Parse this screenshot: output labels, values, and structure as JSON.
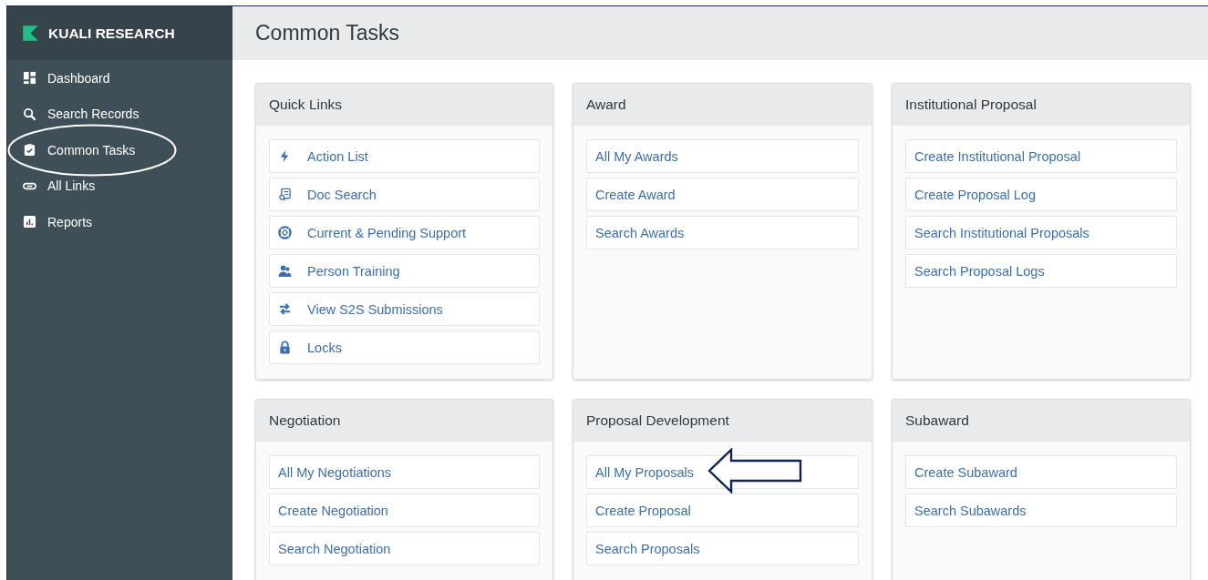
{
  "sidebar": {
    "brand": "KUALI RESEARCH",
    "items": [
      {
        "label": "Dashboard",
        "circled": false
      },
      {
        "label": "Search Records",
        "circled": false
      },
      {
        "label": "Common Tasks",
        "circled": true
      },
      {
        "label": "All Links",
        "circled": false
      },
      {
        "label": "Reports",
        "circled": false
      }
    ]
  },
  "page_title": "Common Tasks",
  "sections": [
    {
      "title": "Quick Links",
      "kind": "icon-links",
      "links": [
        {
          "label": "Action List",
          "arrow": false
        },
        {
          "label": "Doc Search",
          "arrow": false
        },
        {
          "label": "Current & Pending Support",
          "arrow": false
        },
        {
          "label": "Person Training",
          "arrow": false
        },
        {
          "label": "View S2S Submissions",
          "arrow": false
        },
        {
          "label": "Locks",
          "arrow": false
        }
      ]
    },
    {
      "title": "Award",
      "kind": "links",
      "links": [
        {
          "label": "All My Awards",
          "arrow": false
        },
        {
          "label": "Create Award",
          "arrow": false
        },
        {
          "label": "Search Awards",
          "arrow": false
        }
      ]
    },
    {
      "title": "Institutional Proposal",
      "kind": "links",
      "links": [
        {
          "label": "Create Institutional Proposal",
          "arrow": false
        },
        {
          "label": "Create Proposal Log",
          "arrow": false
        },
        {
          "label": "Search Institutional Proposals",
          "arrow": false
        },
        {
          "label": "Search Proposal Logs",
          "arrow": false
        }
      ]
    },
    {
      "title": "Negotiation",
      "kind": "links",
      "links": [
        {
          "label": "All My Negotiations",
          "arrow": false
        },
        {
          "label": "Create Negotiation",
          "arrow": false
        },
        {
          "label": "Search Negotiation",
          "arrow": false
        }
      ]
    },
    {
      "title": "Proposal Development",
      "kind": "links",
      "links": [
        {
          "label": "All My Proposals",
          "arrow": true
        },
        {
          "label": "Create Proposal",
          "arrow": false
        },
        {
          "label": "Search Proposals",
          "arrow": false
        }
      ]
    },
    {
      "title": "Subaward",
      "kind": "links",
      "links": [
        {
          "label": "Create Subaward",
          "arrow": false
        },
        {
          "label": "Search Subawards",
          "arrow": false
        }
      ]
    }
  ]
}
